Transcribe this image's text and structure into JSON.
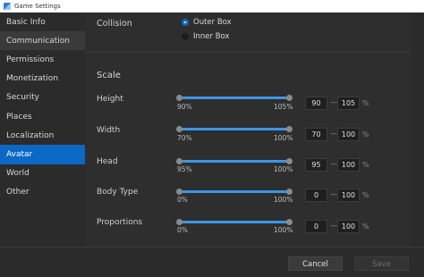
{
  "window": {
    "title": "Game Settings"
  },
  "sidebar": {
    "items": [
      {
        "label": "Basic Info"
      },
      {
        "label": "Communication"
      },
      {
        "label": "Permissions"
      },
      {
        "label": "Monetization"
      },
      {
        "label": "Security"
      },
      {
        "label": "Places"
      },
      {
        "label": "Localization"
      },
      {
        "label": "Avatar"
      },
      {
        "label": "World"
      },
      {
        "label": "Other"
      }
    ],
    "active": "Avatar",
    "hovered": "Communication"
  },
  "collision": {
    "label": "Collision",
    "options": [
      {
        "label": "Outer Box",
        "selected": true
      },
      {
        "label": "Inner Box",
        "selected": false
      }
    ]
  },
  "scale": {
    "heading": "Scale",
    "rows": [
      {
        "label": "Height",
        "min_label": "90%",
        "max_label": "105%",
        "min_value": "90",
        "max_value": "105"
      },
      {
        "label": "Width",
        "min_label": "70%",
        "max_label": "100%",
        "min_value": "70",
        "max_value": "100"
      },
      {
        "label": "Head",
        "min_label": "95%",
        "max_label": "100%",
        "min_value": "95",
        "max_value": "100"
      },
      {
        "label": "Body Type",
        "min_label": "0%",
        "max_label": "100%",
        "min_value": "0",
        "max_value": "100"
      },
      {
        "label": "Proportions",
        "min_label": "0%",
        "max_label": "100%",
        "min_value": "0",
        "max_value": "100"
      }
    ],
    "separator": "—",
    "unit": "%"
  },
  "footer": {
    "cancel_label": "Cancel",
    "save_label": "Save"
  },
  "colors": {
    "accent": "#0b68c4",
    "slider": "#3b96e6",
    "background": "#2e2e2e"
  }
}
